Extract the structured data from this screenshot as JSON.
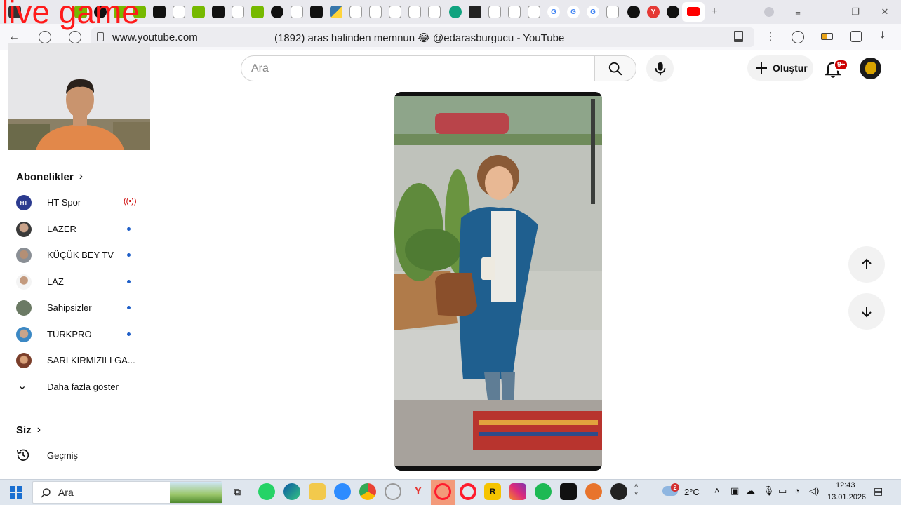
{
  "overlay": {
    "live_text": "live game"
  },
  "browser": {
    "url": "www.youtube.com",
    "tab_title": "(1892) aras halinden memnun 😂 @edarasburgucu - YouTube",
    "new_tab": "+"
  },
  "youtube": {
    "search_placeholder": "Ara",
    "create_label": "Oluştur",
    "notification_badge": "9+"
  },
  "sidebar": {
    "subscriptions_title": "Abonelikler",
    "channels": [
      {
        "name": "HT Spor",
        "avatar_text": "HT"
      },
      {
        "name": "LAZER"
      },
      {
        "name": "KÜÇÜK BEY TV"
      },
      {
        "name": "LAZ"
      },
      {
        "name": "Sahipsizler"
      },
      {
        "name": "TÜRKPRO"
      },
      {
        "name": "SARI KIRMIZILI GA..."
      }
    ],
    "show_more": "Daha fazla göster",
    "you_title": "Siz",
    "history": "Geçmiş"
  },
  "taskbar": {
    "search_placeholder": "Ara",
    "weather_temp": "2°C",
    "weather_badge": "2",
    "time": "12:43",
    "date": "13.01.2026"
  },
  "colors": {
    "live_overlay": "#ff1a1a",
    "youtube_red": "#cc0000",
    "subscription_dot": "#1f5fc8"
  }
}
